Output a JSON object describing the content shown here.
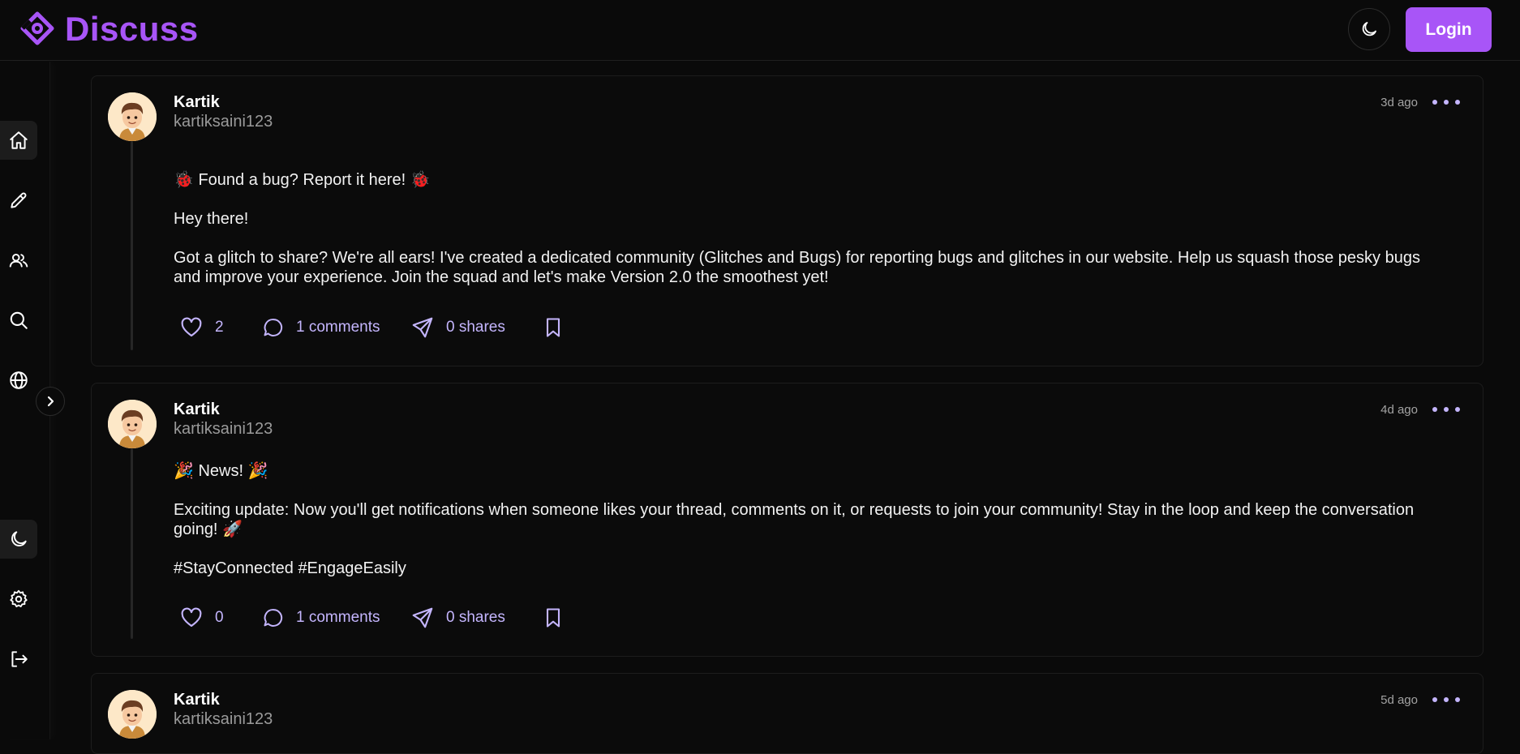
{
  "brand": {
    "name": "Discuss",
    "accent": "#a855f7"
  },
  "header": {
    "login_label": "Login",
    "theme_icon": "moon-icon"
  },
  "sidebar": {
    "items": [
      {
        "name": "home",
        "icon": "home-icon",
        "active": true
      },
      {
        "name": "create",
        "icon": "pencil-icon",
        "active": false
      },
      {
        "name": "communities",
        "icon": "users-icon",
        "active": false
      },
      {
        "name": "search",
        "icon": "search-icon",
        "active": false
      },
      {
        "name": "explore",
        "icon": "globe-icon",
        "active": false
      }
    ],
    "bottom_items": [
      {
        "name": "theme",
        "icon": "moon-icon",
        "active": true
      },
      {
        "name": "settings",
        "icon": "gear-icon",
        "active": false
      },
      {
        "name": "logout",
        "icon": "logout-icon",
        "active": false
      }
    ],
    "expand_icon": "chevron-right-icon"
  },
  "posts": [
    {
      "author": "Kartik",
      "handle": "kartiksaini123",
      "time": "3d ago",
      "paragraphs": [
        "🐞 Found a bug? Report it here! 🐞",
        "Hey there!",
        "Got a glitch to share? We're all ears! I've created a dedicated community (Glitches and Bugs) for reporting bugs and glitches in our website. Help us squash those pesky bugs and improve your experience. Join the squad and let's make Version 2.0 the smoothest yet!"
      ],
      "likes": "2",
      "comments": "1 comments",
      "shares": "0 shares"
    },
    {
      "author": "Kartik",
      "handle": "kartiksaini123",
      "time": "4d ago",
      "paragraphs": [
        "🎉 News! 🎉",
        "Exciting update: Now you'll get notifications when someone likes your thread, comments on it, or requests to join your community! Stay in the loop and keep the conversation going! 🚀",
        "#StayConnected #EngageEasily"
      ],
      "likes": "0",
      "comments": "1 comments",
      "shares": "0 shares"
    },
    {
      "author": "Kartik",
      "handle": "kartiksaini123",
      "time": "5d ago"
    }
  ]
}
